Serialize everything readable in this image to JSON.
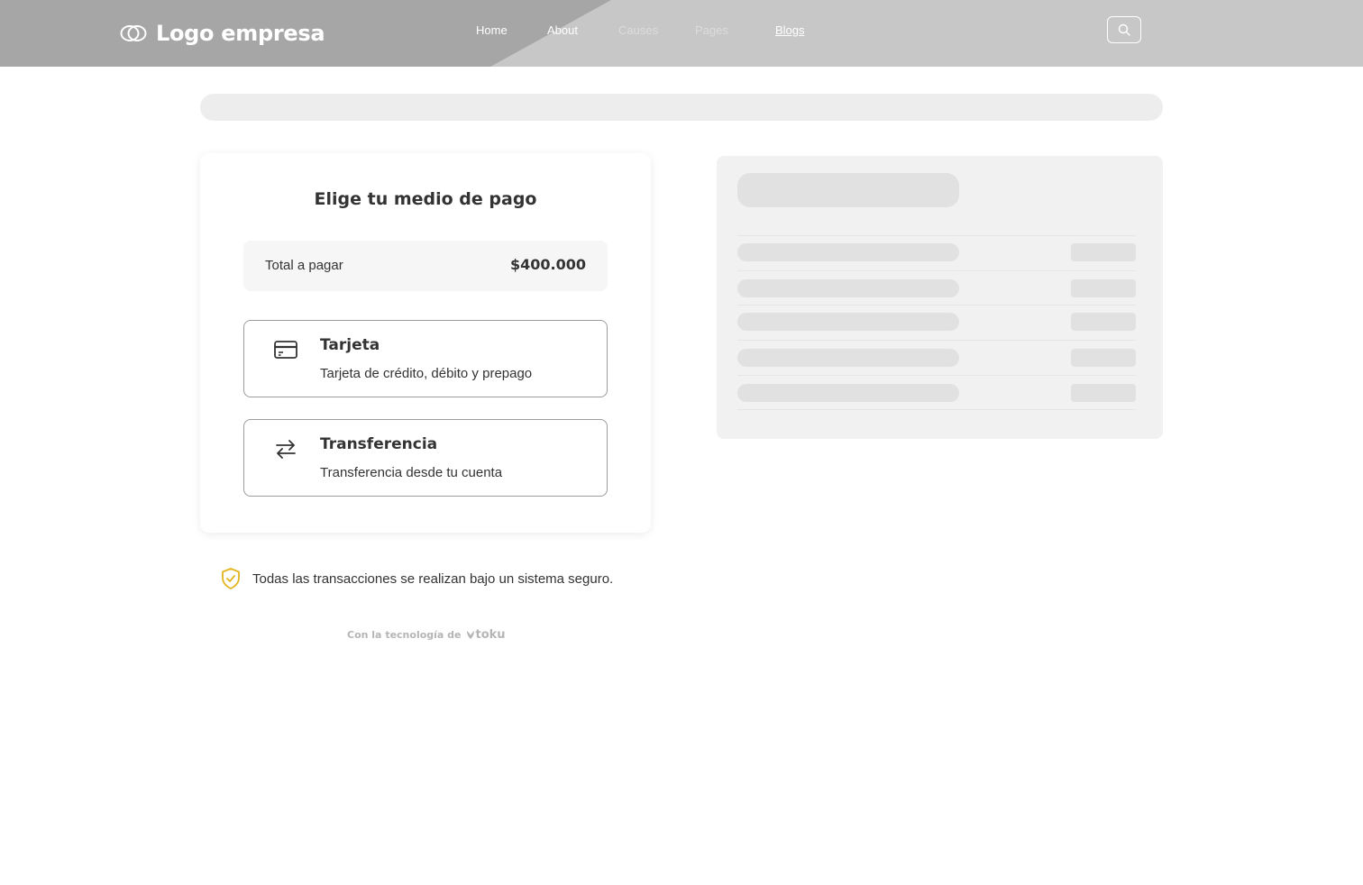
{
  "header": {
    "logo_text": "Logo empresa",
    "nav": [
      {
        "label": "Home",
        "state": "normal"
      },
      {
        "label": "About",
        "state": "normal"
      },
      {
        "label": "Causes",
        "state": "muted"
      },
      {
        "label": "Pages",
        "state": "muted"
      },
      {
        "label": "Blogs",
        "state": "active"
      }
    ],
    "search_icon": "search-icon"
  },
  "payment": {
    "title": "Elige tu medio de pago",
    "total_label": "Total a pagar",
    "total_value": "$400.000",
    "options": [
      {
        "icon": "credit-card-icon",
        "title": "Tarjeta",
        "description": "Tarjeta de crédito, débito y prepago"
      },
      {
        "icon": "transfer-arrows-icon",
        "title": "Transferencia",
        "description": "Transferencia desde tu cuenta"
      }
    ]
  },
  "secure_note": {
    "icon": "shield-check-icon",
    "text": "Todas las transacciones se realizan bajo un sistema seguro."
  },
  "powered_by": {
    "text": "Con la tecnología de",
    "brand": "toku"
  },
  "colors": {
    "header_bg": "#c7c7c7",
    "header_dark": "#a6a6a6",
    "shield": "#e3b51e",
    "skeleton": "#e1e1e1"
  }
}
